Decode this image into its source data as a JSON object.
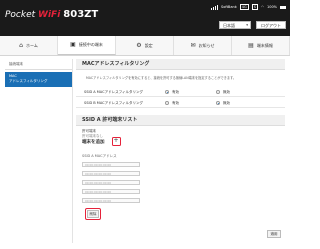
{
  "header": {
    "logo_pocket": "Pocket ",
    "logo_wifi": "WiFi",
    "logo_model": "803ZT",
    "carrier": "SoftBank",
    "network": "4G",
    "sim_badge": "S",
    "battery_pct": "100%",
    "language": "日本語",
    "logout": "ログアウト"
  },
  "nav": {
    "tabs": [
      {
        "label": "ホーム",
        "icon": "home-icon",
        "glyph": "⌂"
      },
      {
        "label": "接続中の端末",
        "icon": "devices-icon",
        "glyph": "▣"
      },
      {
        "label": "設定",
        "icon": "gear-icon",
        "glyph": "⚙"
      },
      {
        "label": "お知らせ",
        "icon": "mail-icon",
        "glyph": "✉"
      },
      {
        "label": "端末情報",
        "icon": "info-icon",
        "glyph": "▤"
      }
    ]
  },
  "sidebar": {
    "head": "接続端末",
    "item_line1": "MAC",
    "item_line2": "アドレスフィルタリング"
  },
  "main": {
    "section_title": "MACアドレスフィルタリング",
    "description": "MACアドレスフィルタリングを有効にすると、接続を許可する無線LAN端末を指定することができます。",
    "ssid_a_label": "SSID A MACアドレスフィルタリング",
    "ssid_b_label": "SSID B MACアドレスフィルタリング",
    "enabled": "有効",
    "disabled": "無効",
    "list_title": "SSID A 許可端末リスト",
    "allowed_label": "許可端末",
    "none_label": "許可端末なし",
    "add_label": "端末を追加",
    "mac_label": "SSID A MACアドレス",
    "mac_placeholder": "00:00:00:00:00:00",
    "delete_button": "削除",
    "apply_button": "適用"
  },
  "colors": {
    "header_bg": "#1a1a1a",
    "accent_blue": "#1a6fb5",
    "highlight_red": "#e5223a"
  }
}
